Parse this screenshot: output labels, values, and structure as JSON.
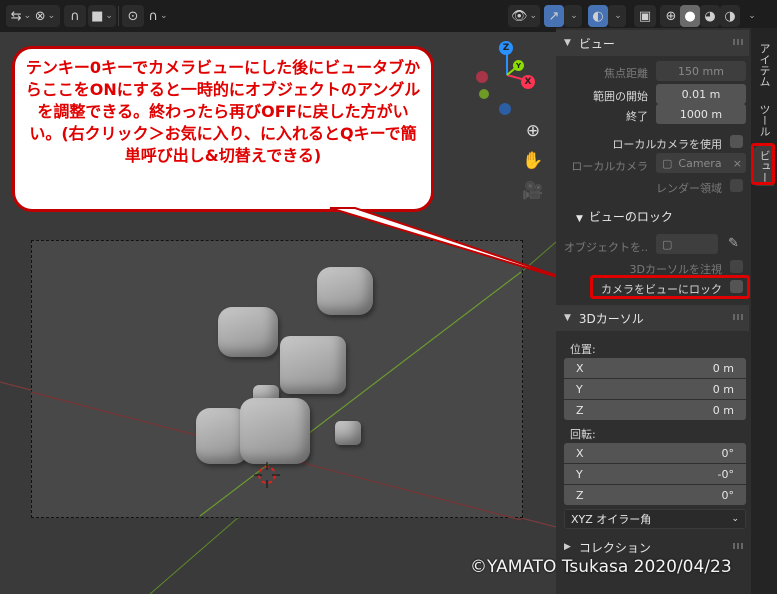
{
  "callout": {
    "text": "テンキー0キーでカメラビューにした後にビュータブからここをONにすると一時的にオブジェクトのアングルを調整できる。終わったら再びOFFに戻した方がいい。(右クリック＞お気に入り、に入れるとQキーで簡単呼び出し&切替えできる)"
  },
  "header": {
    "icons": [
      "snap-icon",
      "proportional-icon",
      "visibility-icon",
      "gizmo-icon",
      "overlay-icon",
      "xray-icon",
      "shading-icon"
    ]
  },
  "gizmo": {
    "x_label": "X",
    "y_label": "Y",
    "z_label": "Z"
  },
  "sidebar": {
    "view_panel": {
      "title": "ビュー",
      "focal_label": "焦点距離",
      "focal_value": "150 mm",
      "clip_start_label": "範囲の開始",
      "clip_start_value": "0.01 m",
      "clip_end_label": "終了",
      "clip_end_value": "1000 m",
      "local_camera_toggle": "ローカルカメラを使用",
      "local_camera_label": "ローカルカメラ",
      "local_camera_value": "Camera",
      "render_region": "レンダー領域"
    },
    "view_lock": {
      "title": "ビューのロック",
      "object_label": "オブジェクトを..",
      "cursor_lock": "3Dカーソルを注視",
      "camera_lock": "カメラをビューにロック"
    },
    "cursor_panel": {
      "title": "3Dカーソル",
      "location_label": "位置:",
      "location": [
        {
          "axis": "X",
          "value": "0 m"
        },
        {
          "axis": "Y",
          "value": "0 m"
        },
        {
          "axis": "Z",
          "value": "0 m"
        }
      ],
      "rotation_label": "回転:",
      "rotation": [
        {
          "axis": "X",
          "value": "0°"
        },
        {
          "axis": "Y",
          "value": "-0°"
        },
        {
          "axis": "Z",
          "value": "0°"
        }
      ],
      "rotation_mode": "XYZ オイラー角"
    },
    "collection_panel": {
      "title": "コレクション"
    }
  },
  "tabs": {
    "item": "アイテム",
    "tool": "ツール",
    "view": "ビュー"
  },
  "copyright": "©YAMATO Tsukasa 2020/04/23",
  "colors": {
    "accent": "#4772b3",
    "annotation": "#e00000",
    "x_axis": "#ff3352",
    "y_axis": "#8bdc00",
    "z_axis": "#2890ff"
  }
}
